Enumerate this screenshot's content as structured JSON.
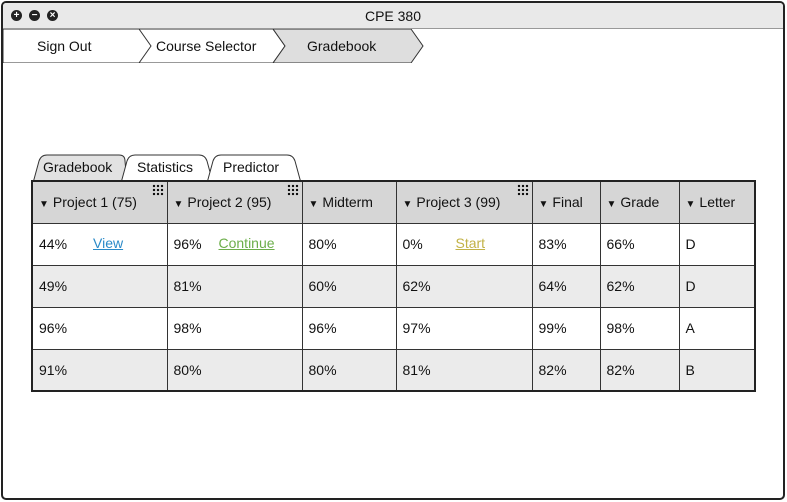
{
  "window": {
    "title": "CPE 380",
    "controls": [
      "+",
      "−",
      "×"
    ]
  },
  "breadcrumb": [
    "Sign Out",
    "Course Selector",
    "Gradebook"
  ],
  "tabs": [
    "Gradebook",
    "Statistics",
    "Predictor"
  ],
  "table": {
    "columns": [
      "Project 1 (75)",
      "Project 2 (95)",
      "Midterm",
      "Project 3 (99)",
      "Final",
      "Grade",
      "Letter"
    ],
    "rows": [
      [
        "44%",
        "96%",
        "80%",
        "0%",
        "83%",
        "66%",
        "D"
      ],
      [
        "49%",
        "81%",
        "60%",
        "62%",
        "64%",
        "62%",
        "D"
      ],
      [
        "96%",
        "98%",
        "96%",
        "97%",
        "99%",
        "98%",
        "A"
      ],
      [
        "91%",
        "80%",
        "80%",
        "81%",
        "82%",
        "82%",
        "B"
      ]
    ],
    "links": {
      "view": "View",
      "continue": "Continue",
      "start": "Start"
    }
  },
  "colors": {
    "view_link": "#2a8ac8",
    "continue_link": "#6cae4a",
    "start_link": "#c2b246"
  }
}
